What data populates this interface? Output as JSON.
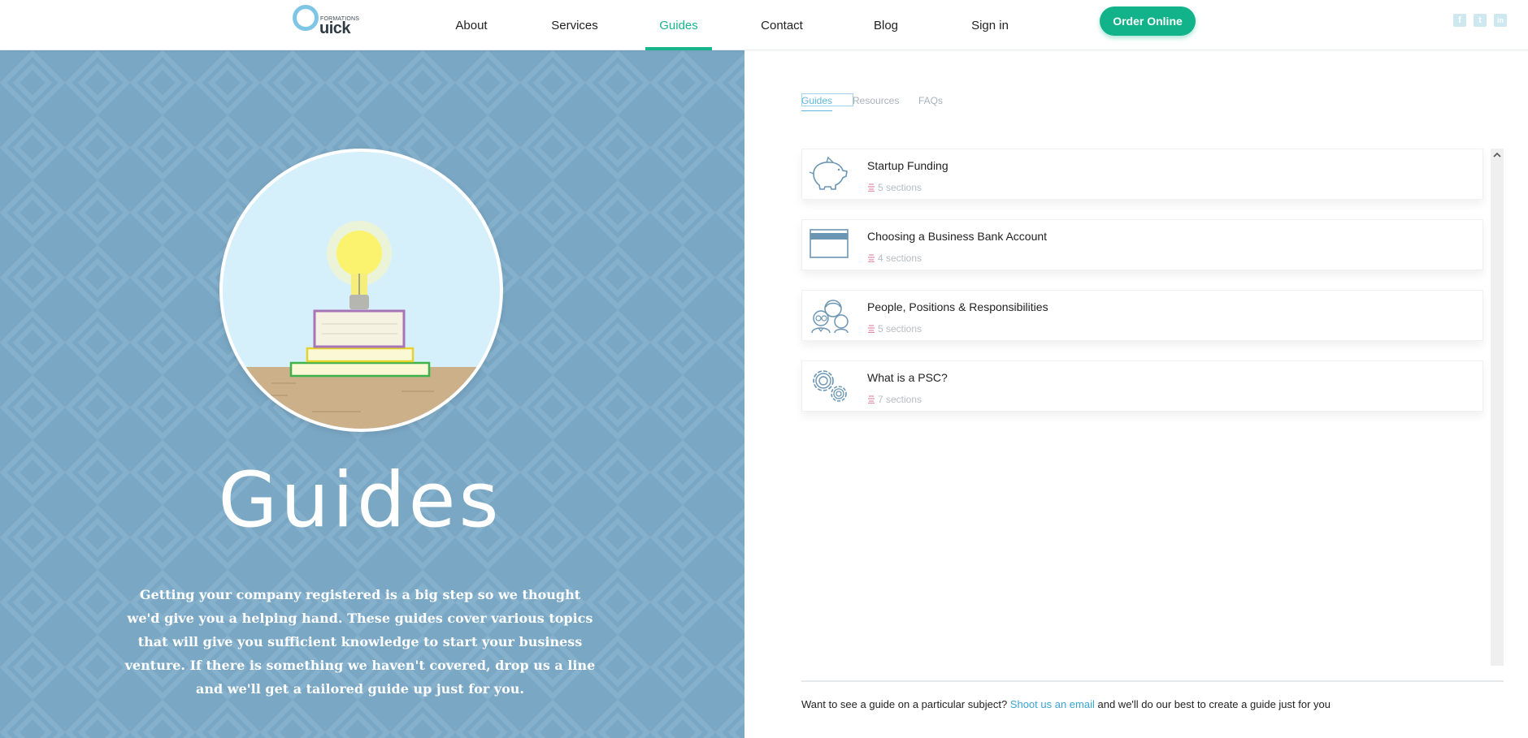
{
  "header": {
    "logo": {
      "small_text": "FORMATIONS",
      "word": "uick"
    },
    "nav": [
      {
        "label": "About",
        "active": false
      },
      {
        "label": "Services",
        "active": false
      },
      {
        "label": "Guides",
        "active": true
      },
      {
        "label": "Contact",
        "active": false
      },
      {
        "label": "Blog",
        "active": false
      },
      {
        "label": "Sign in",
        "active": false
      }
    ],
    "order_button": "Order Online",
    "social": [
      {
        "name": "facebook-icon",
        "glyph": "f"
      },
      {
        "name": "twitter-icon",
        "glyph": "t"
      },
      {
        "name": "linkedin-icon",
        "glyph": "in"
      }
    ]
  },
  "hero": {
    "title": "Guides",
    "description": "Getting your company registered is a big step so we thought we'd give you a helping hand. These guides cover various topics that will give you sufficient knowledge to start your business venture. If there is something we haven't covered, drop us a line and we'll get a tailored guide up just for you."
  },
  "tabs": [
    {
      "label": "Guides",
      "active": true
    },
    {
      "label": "Resources",
      "active": false
    },
    {
      "label": "FAQs",
      "active": false
    }
  ],
  "guides": [
    {
      "title": "Startup Funding",
      "sections": "5 sections",
      "icon": "piggy-bank-icon"
    },
    {
      "title": "Choosing a Business Bank Account",
      "sections": "4 sections",
      "icon": "bank-card-icon"
    },
    {
      "title": "People, Positions & Responsibilities",
      "sections": "5 sections",
      "icon": "people-icon"
    },
    {
      "title": "What is a PSC?",
      "sections": "7 sections",
      "icon": "gears-icon"
    }
  ],
  "footer": {
    "before": "Want to see a guide on a particular subject?",
    "link": "Shoot us an email",
    "after": "and we'll do our best to create a guide just for you"
  },
  "colors": {
    "accent_green": "#17b58c",
    "hero_blue": "#7aa7c4",
    "link_blue": "#3aa3d4",
    "icon_blue": "#6a95b3",
    "section_icon_pink": "#e08fa8"
  }
}
